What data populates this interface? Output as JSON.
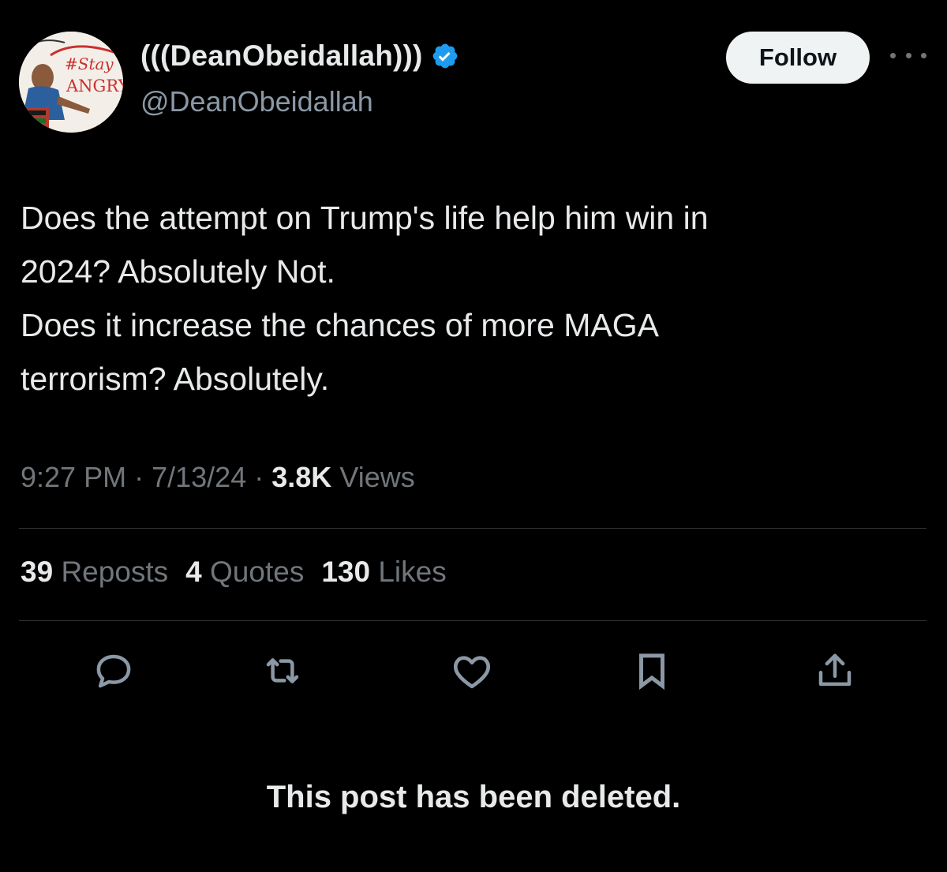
{
  "author": {
    "display_name": "(((DeanObeidallah)))",
    "handle": "@DeanObeidallah",
    "avatar_text": [
      "#Stay",
      "ANGRY"
    ],
    "verified_color": "#1d9bf0"
  },
  "header": {
    "follow_label": "Follow",
    "more_icon": "more-icon"
  },
  "post": {
    "text_lines": [
      "Does the attempt on Trump's life help him win in",
      "2024? Absolutely Not.",
      "Does it increase the chances of more MAGA",
      "terrorism? Absolutely."
    ],
    "time": "9:27 PM",
    "date": "7/13/24",
    "separator": "·",
    "views_count": "3.8K",
    "views_label": "Views"
  },
  "stats": {
    "reposts_count": "39",
    "reposts_label": "Reposts",
    "quotes_count": "4",
    "quotes_label": "Quotes",
    "likes_count": "130",
    "likes_label": "Likes"
  },
  "actions": [
    "reply-icon",
    "repost-icon",
    "like-icon",
    "bookmark-icon",
    "share-icon"
  ],
  "notice": "This post has been deleted.",
  "colors": {
    "background": "#000000",
    "text": "#e7e9ea",
    "muted": "#71767b",
    "divider": "#2f3336"
  }
}
